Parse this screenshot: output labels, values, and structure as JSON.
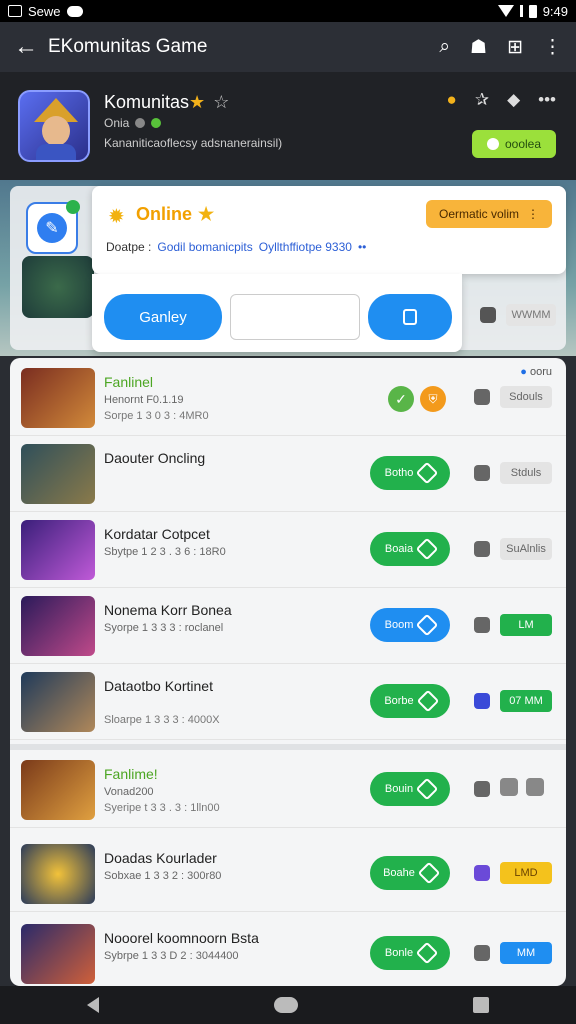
{
  "status_bar": {
    "app_label": "Sewe",
    "time": "9:49"
  },
  "app_bar": {
    "title": "EKomunitas Game"
  },
  "header": {
    "name": "Komunitas",
    "status": "Onia",
    "description": "Kananiticaoflecsy adsnanerainsil)",
    "online_button": "ooolea"
  },
  "popup": {
    "online_label": "Online",
    "orange_button": "Oermatic volim",
    "line_prefix": "Doatpe :",
    "line_link1": "Godil bomanicpits",
    "line_link2": "Oyllthffiotpe 9330",
    "button_left": "Ganley"
  },
  "scene": {
    "tag": "WWMM"
  },
  "rows": [
    {
      "name": "Fanlinel",
      "sub": "Henornt F0.1.19",
      "sub2": "Sorpe 1 3 0 3 : 4MR0",
      "corner": "ooru",
      "tag": "Sdouls"
    },
    {
      "name": "Daouter Oncling",
      "sub": "",
      "sub2": "",
      "action": "Botho",
      "tag": "Stduls"
    },
    {
      "name": "Kordatar Cotpcet",
      "sub": "Sbytpe 1 2 3 . 3 6 : 18R0",
      "sub2": "",
      "action": "Boaia",
      "tag": "SuAlnlis"
    },
    {
      "name": "Nonema Korr Bonea",
      "sub": "Syorpe 1 3 3 3 : roclanel",
      "sub2": "",
      "action": "Boom",
      "tag": "LM"
    },
    {
      "name": "Dataotbo Kortinet",
      "sub": "Sloarpe 1 3 3 3 : 4000X",
      "sub2": "",
      "action": "Borbe",
      "tag": "07 MM"
    },
    {
      "name": "Fanlime!",
      "sub": "Vonad200",
      "sub2": "Syeripe t 3 3 . 3 : 1lln00",
      "action": "Bouin"
    },
    {
      "name": "Doadas Kourlader",
      "sub": "Sobxae 1 3 3 2 : 300r80",
      "sub2": "",
      "action": "Boahe",
      "tag": "LMD"
    },
    {
      "name": "Nooorel koomnoorn Bsta",
      "sub": "Sybrpe 1 3 3 D 2 : 3044400",
      "sub2": "",
      "action": "Bonle",
      "tag": "MM"
    }
  ]
}
